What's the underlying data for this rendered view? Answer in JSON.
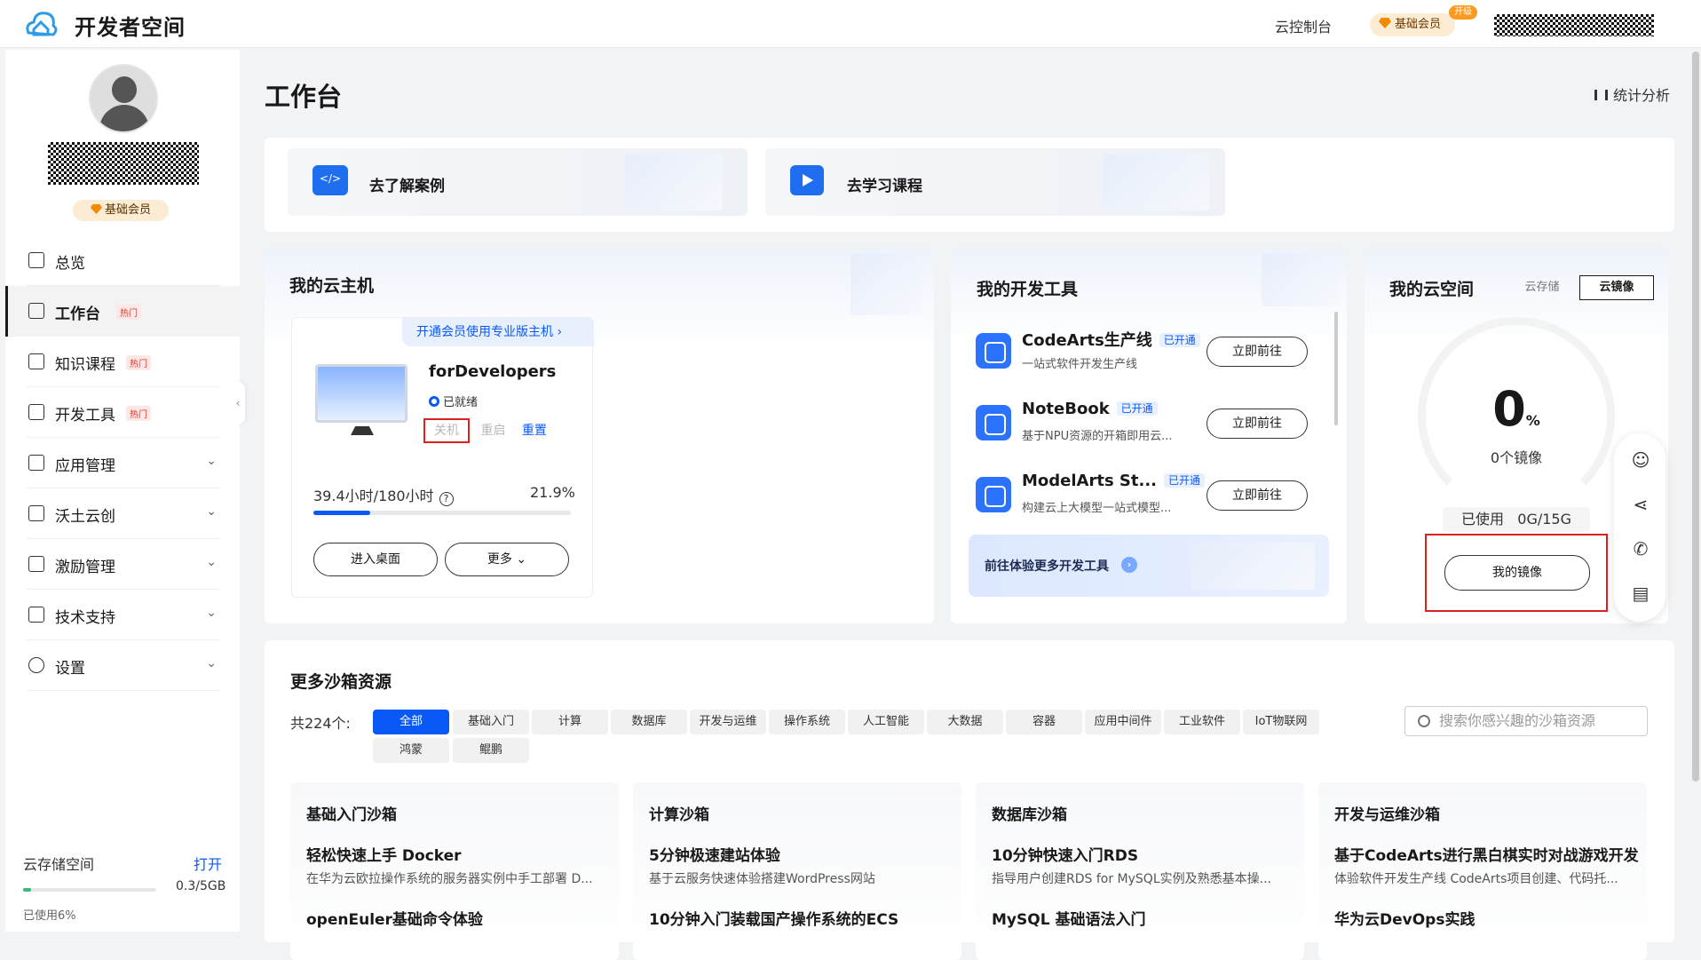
{
  "topbar": {
    "brand": "开发者空间",
    "console_link": "云控制台",
    "member_label": "基础会员",
    "upgrade_tag": "开级"
  },
  "sidebar": {
    "member_label": "基础会员",
    "nav": [
      {
        "label": "总览",
        "icon": "dashboard-icon",
        "hot": "",
        "expand": false
      },
      {
        "label": "工作台",
        "icon": "workbench-icon",
        "hot": "热门",
        "expand": false
      },
      {
        "label": "知识课程",
        "icon": "cube-icon",
        "hot": "热门",
        "expand": false
      },
      {
        "label": "开发工具",
        "icon": "document-icon",
        "hot": "热门",
        "expand": false
      },
      {
        "label": "应用管理",
        "icon": "app-icon",
        "hot": "",
        "expand": true
      },
      {
        "label": "沃土云创",
        "icon": "cloud-icon",
        "hot": "",
        "expand": true
      },
      {
        "label": "激励管理",
        "icon": "gift-icon",
        "hot": "",
        "expand": true
      },
      {
        "label": "技术支持",
        "icon": "monitor-icon",
        "hot": "",
        "expand": true
      },
      {
        "label": "设置",
        "icon": "gear-icon",
        "hot": "",
        "expand": true
      }
    ],
    "storage": {
      "title": "云存储空间",
      "open_label": "打开",
      "amount": "0.3/5GB",
      "used": "已使用6%",
      "used_fraction": 0.06
    }
  },
  "main": {
    "title": "工作台",
    "stats_label": "统计分析",
    "quick": [
      {
        "label": "去了解案例"
      },
      {
        "label": "去学习课程"
      }
    ],
    "host": {
      "title": "我的云主机",
      "banner": "开通会员使用专业版主机",
      "name": "forDevelopers",
      "status": "已就绪",
      "actions": {
        "shutdown": "关机",
        "restart": "重启",
        "reset": "重置"
      },
      "usage": "39.4小时/180小时",
      "percent": "21.9%",
      "progress": 0.219,
      "enter_label": "进入桌面",
      "more_label": "更多"
    },
    "tools": {
      "title": "我的开发工具",
      "items": [
        {
          "name": "CodeArts生产线",
          "badge": "已开通",
          "desc": "一站式软件开发生产线",
          "go": "立即前往"
        },
        {
          "name": "NoteBook",
          "badge": "已开通",
          "desc": "基于NPU资源的开箱即用云...",
          "go": "立即前往"
        },
        {
          "name": "ModelArts St...",
          "badge": "已开通",
          "desc": "构建云上大模型一站式模型...",
          "go": "立即前往"
        }
      ],
      "more": "前往体验更多开发工具"
    },
    "space": {
      "title": "我的云空间",
      "tabs": [
        "云存储",
        "云镜像"
      ],
      "active_tab": "云镜像",
      "value": "0",
      "unit": "%",
      "label": "0个镜像",
      "used_label": "已使用",
      "used_value": "0G/15G",
      "button": "我的镜像"
    },
    "float_icons": [
      "smile-icon",
      "share-icon",
      "phone-icon",
      "feedback-icon"
    ],
    "sandbox": {
      "title": "更多沙箱资源",
      "count": "共224个:",
      "filters": [
        "全部",
        "基础入门",
        "计算",
        "数据库",
        "开发与运维",
        "操作系统",
        "人工智能",
        "大数据",
        "容器",
        "应用中间件",
        "工业软件",
        "IoT物联网",
        "鸿蒙",
        "鲲鹏"
      ],
      "active_filter": "全部",
      "search_placeholder": "搜索你感兴趣的沙箱资源",
      "columns": [
        {
          "heading": "基础入门沙箱",
          "item1": "轻松快速上手 Docker",
          "desc1": "在华为云欧拉操作系统的服务器实例中手工部署 D...",
          "item2": "openEuler基础命令体验"
        },
        {
          "heading": "计算沙箱",
          "item1": "5分钟极速建站体验",
          "desc1": "基于云服务快速体验搭建WordPress网站",
          "item2": "10分钟入门装载国产操作系统的ECS"
        },
        {
          "heading": "数据库沙箱",
          "item1": "10分钟快速入门RDS",
          "desc1": "指导用户创建RDS for MySQL实例及熟悉基本操...",
          "item2": "MySQL 基础语法入门"
        },
        {
          "heading": "开发与运维沙箱",
          "item1": "基于CodeArts进行黑白棋实时对战游戏开发",
          "desc1": "体验软件开发生产线 CodeArts项目创建、代码托...",
          "item2": "华为云DevOps实践"
        }
      ]
    }
  }
}
